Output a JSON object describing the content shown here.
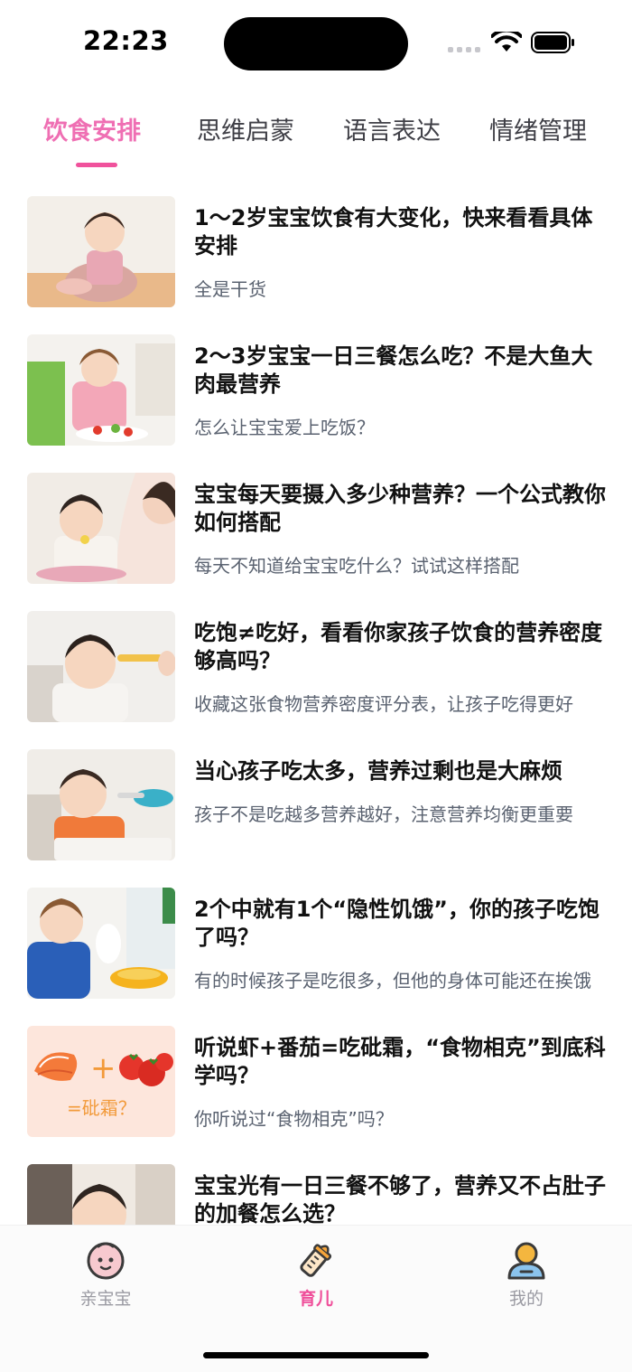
{
  "status": {
    "time": "22:23"
  },
  "tabs": [
    {
      "label": "饮食安排"
    },
    {
      "label": "思维启蒙"
    },
    {
      "label": "语言表达"
    },
    {
      "label": "情绪管理"
    }
  ],
  "articles": [
    {
      "title": "1～2岁宝宝饮食有大变化，快来看看具体安排",
      "subtitle": "全是干货"
    },
    {
      "title": "2～3岁宝宝一日三餐怎么吃？不是大鱼大肉最营养",
      "subtitle": "怎么让宝宝爱上吃饭？"
    },
    {
      "title": "宝宝每天要摄入多少种营养？一个公式教你如何搭配",
      "subtitle": "每天不知道给宝宝吃什么？试试这样搭配"
    },
    {
      "title": "吃饱≠吃好，看看你家孩子饮食的营养密度够高吗？",
      "subtitle": "收藏这张食物营养密度评分表，让孩子吃得更好"
    },
    {
      "title": "当心孩子吃太多，营养过剩也是大麻烦",
      "subtitle": "孩子不是吃越多营养越好，注意营养均衡更重要"
    },
    {
      "title": "2个中就有1个“隐性饥饿”，你的孩子吃饱了吗？",
      "subtitle": "有的时候孩子是吃很多，但他的身体可能还在挨饿"
    },
    {
      "title": "听说虾+番茄=吃砒霜，“食物相克”到底科学吗？",
      "subtitle": "你听说过“食物相克”吗？",
      "thumb_text": {
        "plus": "+",
        "caption": "=砒霜？"
      }
    },
    {
      "title": "宝宝光有一日三餐不够了，营养又不占肚子的加餐怎么选？",
      "subtitle": ""
    }
  ],
  "bottom_nav": [
    {
      "label": "亲宝宝",
      "icon": "baby-face-icon"
    },
    {
      "label": "育儿",
      "icon": "baby-bottle-icon"
    },
    {
      "label": "我的",
      "icon": "user-profile-icon"
    }
  ],
  "colors": {
    "accent": "#ef6fb3",
    "nav_active": "#ef4f9a",
    "text": "#111111",
    "subtext": "#5a6270"
  }
}
